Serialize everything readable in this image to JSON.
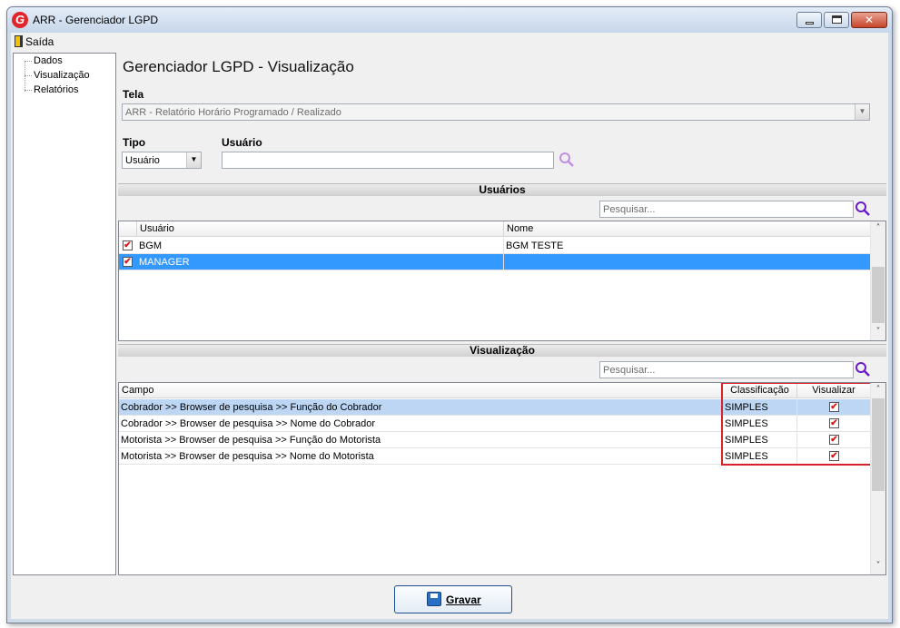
{
  "window": {
    "title": "ARR - Gerenciador LGPD",
    "logo_letter": "G",
    "close_glyph": "✕"
  },
  "menu": {
    "exit_label": "Saída"
  },
  "tree": {
    "items": [
      "Dados",
      "Visualização",
      "Relatórios"
    ]
  },
  "page_title": "Gerenciador LGPD - Visualização",
  "tela": {
    "label": "Tela",
    "value": "ARR - Relatório Horário Programado / Realizado"
  },
  "tipo": {
    "label": "Tipo",
    "value": "Usuário"
  },
  "usuario": {
    "label": "Usuário",
    "value": ""
  },
  "usuarios_section": {
    "title": "Usuários",
    "search_placeholder": "Pesquisar...",
    "columns": [
      "Usuário",
      "Nome"
    ],
    "rows": [
      {
        "checked": true,
        "usuario": "BGM",
        "nome": "BGM TESTE",
        "selected": false
      },
      {
        "checked": true,
        "usuario": "MANAGER",
        "nome": "",
        "selected": true
      }
    ]
  },
  "visualizacao_section": {
    "title": "Visualização",
    "search_placeholder": "Pesquisar...",
    "columns": [
      "Campo",
      "Classificação",
      "Visualizar"
    ],
    "rows": [
      {
        "campo": "Cobrador >> Browser de pesquisa >> Função do Cobrador",
        "classificacao": "SIMPLES",
        "visualizar": true,
        "selected": true
      },
      {
        "campo": "Cobrador >> Browser de pesquisa >> Nome do Cobrador",
        "classificacao": "SIMPLES",
        "visualizar": true,
        "selected": false
      },
      {
        "campo": "Motorista >> Browser de pesquisa >> Função do Motorista",
        "classificacao": "SIMPLES",
        "visualizar": true,
        "selected": false
      },
      {
        "campo": "Motorista >> Browser de pesquisa >> Nome do Motorista",
        "classificacao": "SIMPLES",
        "visualizar": true,
        "selected": false
      }
    ]
  },
  "actions": {
    "save_label": "Gravar"
  },
  "colors": {
    "selection": "#3399ff",
    "selection_light": "#bcd6f3",
    "highlight_border": "#d8212a",
    "search_icon": "#6a1bc8"
  }
}
